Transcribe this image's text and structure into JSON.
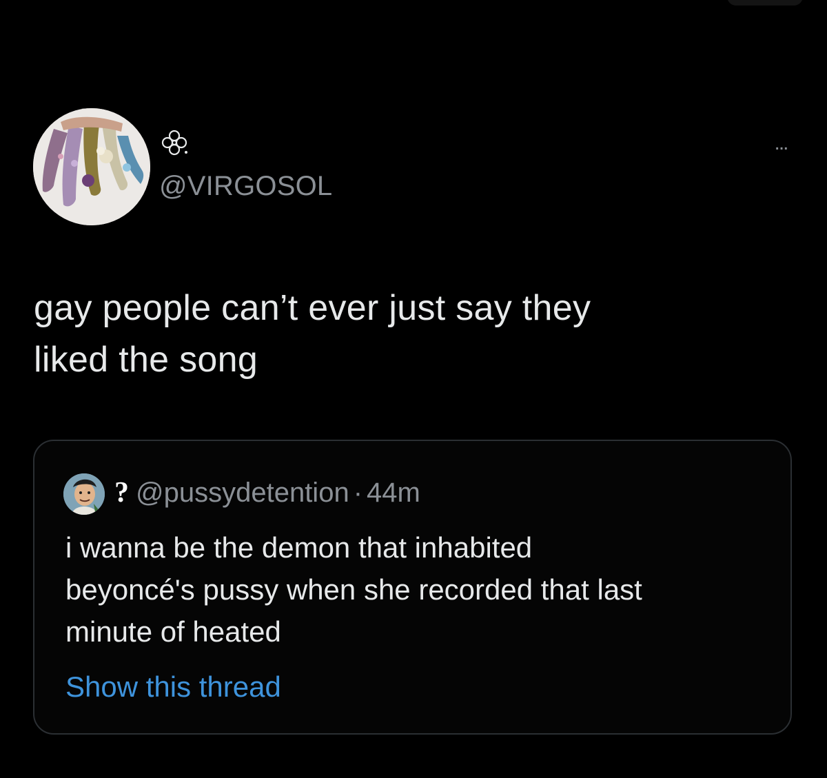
{
  "colors": {
    "background": "#000000",
    "text_primary": "#e7e9ea",
    "text_secondary": "#8b9096",
    "link": "#3e93dc",
    "card_border": "#2b2f33"
  },
  "tweet": {
    "author": {
      "display_name_icon": "clover-flower-icon",
      "handle": "@VIRGOSOL",
      "avatar_icon": "decorated-nails-avatar"
    },
    "more_label": "...",
    "text": "gay people can’t ever just say they\nliked the song",
    "quoted_tweet": {
      "avatar_icon": "cartoon-man-avatar",
      "display_name": "?",
      "handle": "@pussydetention",
      "separator": "·",
      "time": "44m",
      "text": "i wanna be the demon that inhabited\nbeyoncé's pussy when she recorded that last\nminute of heated",
      "show_thread_label": "Show this thread"
    }
  }
}
